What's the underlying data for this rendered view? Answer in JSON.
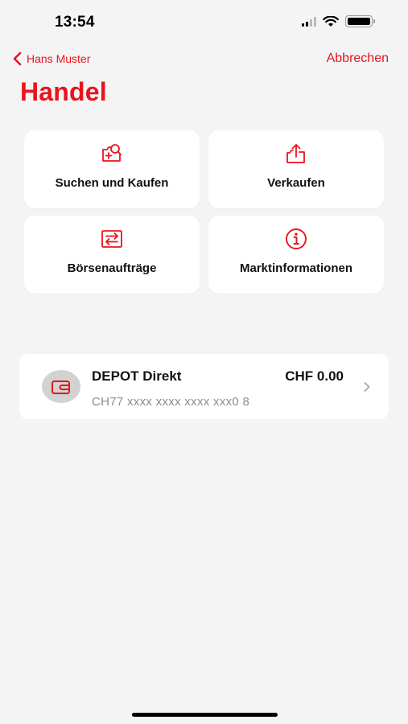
{
  "status_bar": {
    "time": "13:54",
    "icons": [
      "signal-icon",
      "wifi-icon",
      "battery-icon"
    ]
  },
  "nav": {
    "back_label": "Hans Muster",
    "cancel_label": "Abbrechen"
  },
  "title": "Handel",
  "tiles": [
    {
      "label": "Suchen und Kaufen",
      "icon": "search-buy-icon"
    },
    {
      "label": "Verkaufen",
      "icon": "share-sell-icon"
    },
    {
      "label": "Börsenaufträge",
      "icon": "exchange-orders-icon"
    },
    {
      "label": "Marktinformationen",
      "icon": "info-icon"
    }
  ],
  "account": {
    "name": "DEPOT Direkt",
    "balance": "CHF 0.00",
    "iban": "CH77 xxxx xxxx xxxx xxx0 8",
    "icon": "wallet-icon"
  },
  "colors": {
    "accent": "#e8141c",
    "background": "#f4f4f4",
    "card": "#ffffff",
    "secondary_text": "#8c8c8c"
  }
}
